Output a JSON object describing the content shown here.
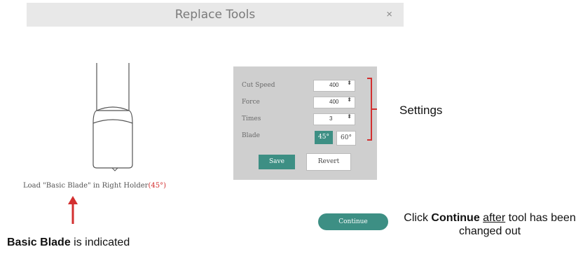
{
  "dialog": {
    "title": "Replace Tools",
    "close_glyph": "×",
    "close_icon": "close-icon",
    "blade_icon": "blade-holder-icon"
  },
  "load_message": {
    "prefix": "Load \"Basic Blade\" in Right Holder",
    "degree": "(45°)"
  },
  "settings": {
    "rows": [
      {
        "label": "Cut Speed",
        "value": "400"
      },
      {
        "label": "Force",
        "value": "400"
      },
      {
        "label": "Times",
        "value": "3"
      }
    ],
    "blade_label": "Blade",
    "blade_options": [
      {
        "label": "45°",
        "selected": true
      },
      {
        "label": "60°",
        "selected": false
      }
    ],
    "spinner_glyph": "⬍",
    "save_label": "Save",
    "revert_label": "Revert"
  },
  "continue_label": "Continue",
  "annotations": {
    "settings_label": "Settings",
    "caption_bold": "Basic Blade",
    "caption_rest": " is indicated",
    "note_prefix": "Click ",
    "note_bold": "Continue",
    "note_space": " ",
    "note_underline": "after",
    "note_rest": " tool has  been changed out"
  },
  "colors": {
    "accent": "#3d8f84",
    "annotation_red": "#d32f2f",
    "panel_bg": "#cfcfcf",
    "titlebar_bg": "#e8e8e8"
  }
}
